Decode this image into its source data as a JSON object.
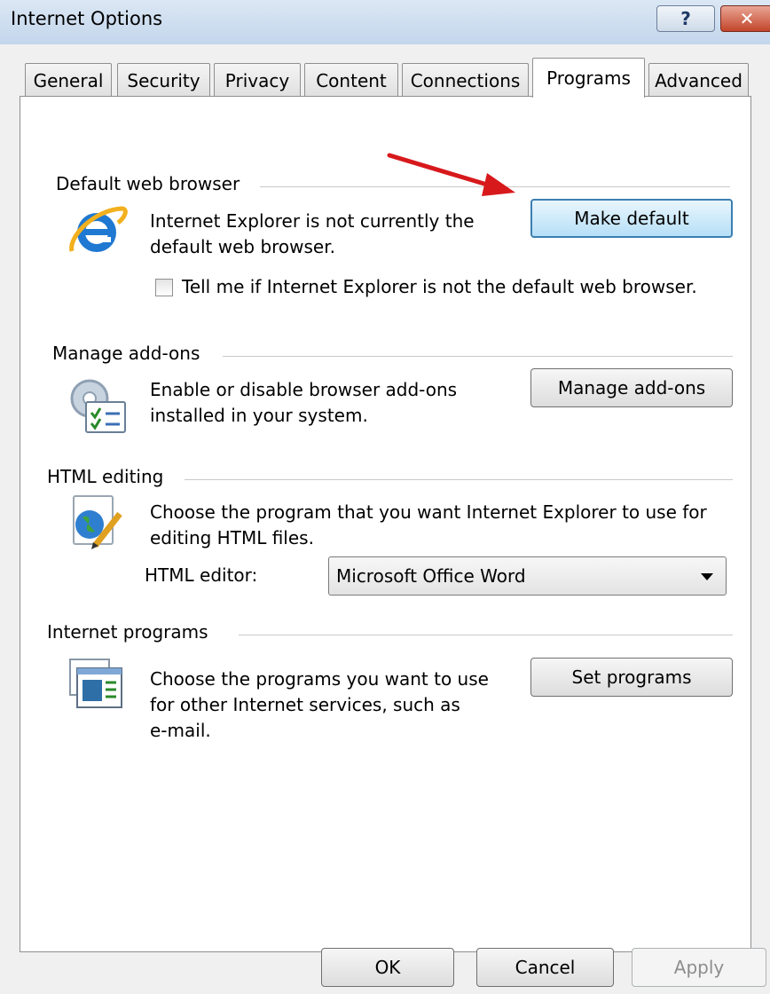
{
  "window": {
    "title": "Internet Options",
    "help_glyph": "?",
    "close_glyph": "✕"
  },
  "tabs": [
    {
      "label": "General"
    },
    {
      "label": "Security"
    },
    {
      "label": "Privacy"
    },
    {
      "label": "Content"
    },
    {
      "label": "Connections"
    },
    {
      "label": "Programs"
    },
    {
      "label": "Advanced"
    }
  ],
  "active_tab": "Programs",
  "default_browser": {
    "heading": "Default web browser",
    "description_line1": "Internet Explorer is not currently the",
    "description_line2": "default web browser.",
    "button_label": "Make default",
    "checkbox_label": "Tell me if Internet Explorer is not the default web browser.",
    "checkbox_checked": false
  },
  "addons": {
    "heading": "Manage add-ons",
    "description_line1": "Enable or disable browser add-ons",
    "description_line2": "installed in your system.",
    "button_label": "Manage add-ons"
  },
  "html_editing": {
    "heading": "HTML editing",
    "description_line1": "Choose the program that you want Internet Explorer to use for",
    "description_line2": "editing HTML files.",
    "editor_label": "HTML editor:",
    "editor_value": "Microsoft Office Word"
  },
  "internet_programs": {
    "heading": "Internet programs",
    "description_line1": "Choose the programs you want to use",
    "description_line2": "for other Internet services, such as",
    "description_line3": "e-mail.",
    "button_label": "Set programs"
  },
  "footer": {
    "ok_label": "OK",
    "cancel_label": "Cancel",
    "apply_label": "Apply",
    "apply_enabled": false
  },
  "icons": {
    "browser": "internet-explorer-icon",
    "addons": "addons-gear-checklist-icon",
    "html_editing": "globe-pencil-icon",
    "programs": "programs-window-icon",
    "annotation": "red-arrow-icon"
  },
  "colors": {
    "title_bar": "#c3d6ec",
    "close_button": "#c2452a",
    "focused_button": "#b6dff7",
    "annotation_arrow": "#d7191c"
  }
}
